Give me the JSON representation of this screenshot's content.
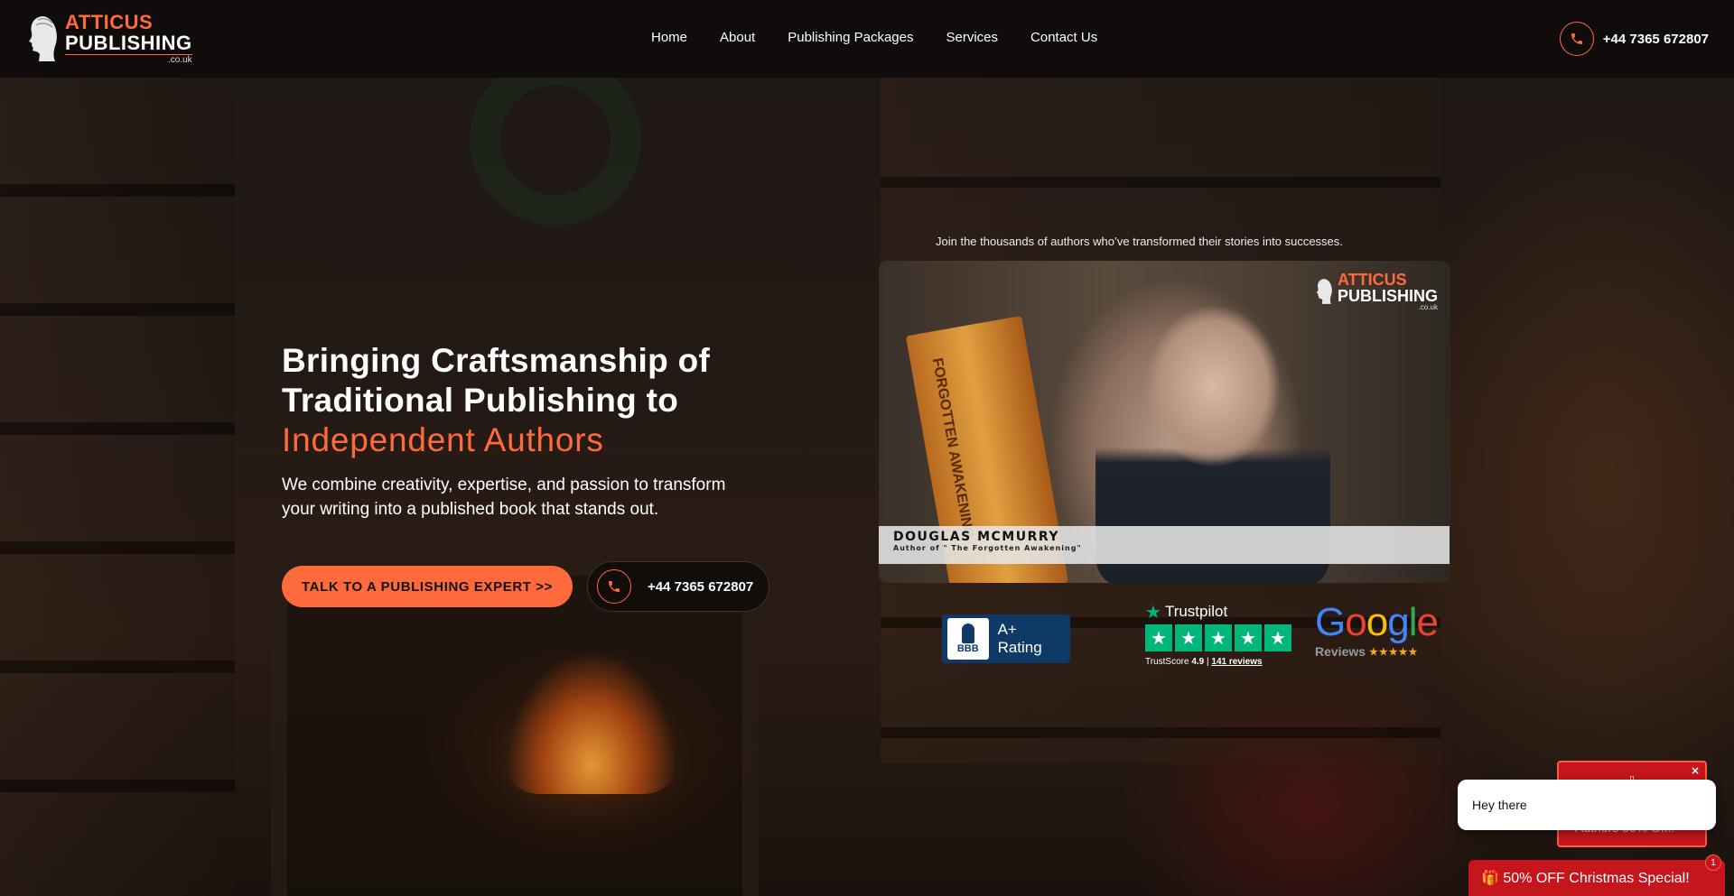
{
  "header": {
    "logo": {
      "line1": "ATTICUS",
      "line2": "PUBLISHING",
      "line3": ".co.uk"
    },
    "nav": [
      {
        "label": "Home"
      },
      {
        "label": "About"
      },
      {
        "label": "Publishing Packages"
      },
      {
        "label": "Services"
      },
      {
        "label": "Contact Us"
      }
    ],
    "phone": "+44 7365 672807",
    "phone_icon": "phone-icon"
  },
  "hero": {
    "title_line1": "Bringing Craftsmanship of",
    "title_line2": "Traditional Publishing to",
    "title_accent": "Independent Authors",
    "description": "We combine creativity, expertise, and passion to transform your writing into a published book that stands out.",
    "cta_label": "TALK TO A PUBLISHING EXPERT >>",
    "phone": "+44 7365 672807"
  },
  "video": {
    "intro_text": "Join the thousands of authors who’ve transformed their stories into successes.",
    "book_title": "FORGOTTEN AWAKENING",
    "logo": {
      "line1": "ATTICUS",
      "line2": "PUBLISHING",
      "line3": ".co.uk"
    },
    "person_name": "DOUGLAS MCMURRY",
    "person_subtitle": "Author of \" The Forgotten Awakening\""
  },
  "badges": {
    "bbb": {
      "mark": "BBB",
      "label": "A+ Rating"
    },
    "trustpilot": {
      "name": "Trustpilot",
      "score_label": "TrustScore",
      "score": "4.9",
      "separator": "|",
      "reviews": "141 reviews",
      "stars": 5
    },
    "google": {
      "word": "Google",
      "sub": "Reviews",
      "stars": "★★★★★"
    }
  },
  "widgets": {
    "promo_close": "×",
    "promo_text": "Authors 50% Off!!",
    "chat_text": "Hey there",
    "xmas_text": "🎁 50% OFF Christmas Special!",
    "xmas_badge": "1"
  },
  "colors": {
    "accent": "#ff6a3c",
    "header_bg": "#0f0c0b",
    "promo_red": "#c4161c",
    "trustpilot_green": "#00b67a",
    "bbb_blue": "#0f3a67"
  }
}
